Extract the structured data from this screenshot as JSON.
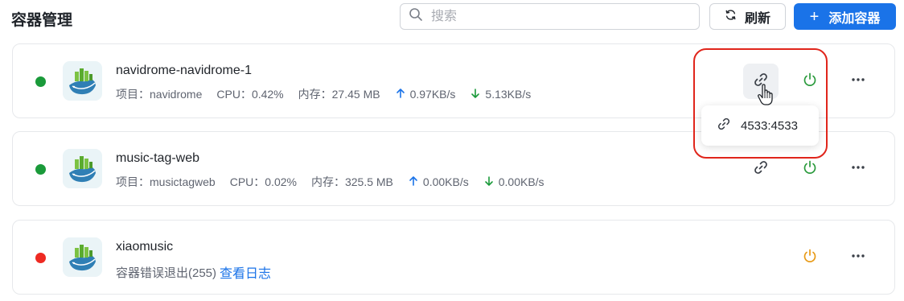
{
  "header": {
    "title": "容器管理",
    "search_placeholder": "搜索",
    "refresh_label": "刷新",
    "add_label": "添加容器"
  },
  "labels": {
    "project": "项目：",
    "cpu": "CPU：",
    "memory": "内存："
  },
  "colors": {
    "running": "#1a9a3a",
    "stopped": "#ee2a22",
    "accent": "#1a73e8",
    "power_running": "#2a9a3c",
    "power_stopped": "#e89a16",
    "upload_arrow": "#1a73e8",
    "download_arrow": "#1a9a3a",
    "highlight": "#e0251b"
  },
  "containers": [
    {
      "name": "navidrome-navidrome-1",
      "status": "running",
      "project": "navidrome",
      "cpu": "0.42%",
      "memory": "27.45 MB",
      "upload": "0.97KB/s",
      "download": "5.13KB/s"
    },
    {
      "name": "music-tag-web",
      "status": "running",
      "project": "musictagweb",
      "cpu": "0.02%",
      "memory": "325.5 MB",
      "upload": "0.00KB/s",
      "download": "0.00KB/s"
    },
    {
      "name": "xiaomusic",
      "status": "stopped",
      "error_text": "容器错误退出(255)",
      "log_link": "查看日志"
    }
  ],
  "port_popover": {
    "port_mapping": "4533:4533"
  },
  "icons": {
    "search": "search-icon",
    "refresh": "refresh-icon",
    "add": "plus-icon",
    "link": "link-icon",
    "power": "power-icon",
    "more": "more-icon",
    "upload": "arrow-up-icon",
    "download": "arrow-down-icon",
    "app": "whale-app-icon",
    "cursor": "hand-pointer-icon"
  }
}
